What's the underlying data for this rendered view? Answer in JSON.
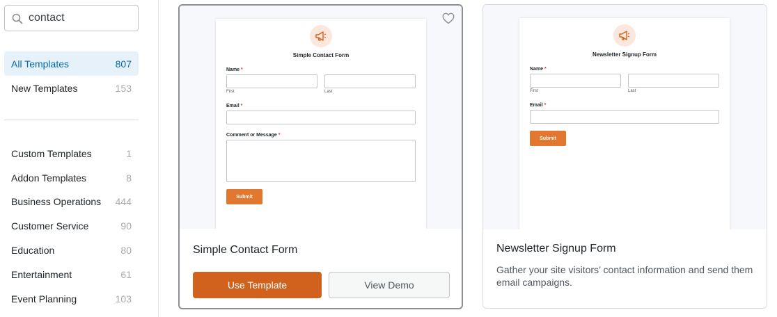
{
  "search": {
    "value": "contact"
  },
  "categories_top": [
    {
      "label": "All Templates",
      "count": "807",
      "active": true
    },
    {
      "label": "New Templates",
      "count": "153"
    }
  ],
  "categories": [
    {
      "label": "Custom Templates",
      "count": "1"
    },
    {
      "label": "Addon Templates",
      "count": "8"
    },
    {
      "label": "Business Operations",
      "count": "444"
    },
    {
      "label": "Customer Service",
      "count": "90"
    },
    {
      "label": "Education",
      "count": "80"
    },
    {
      "label": "Entertainment",
      "count": "61"
    },
    {
      "label": "Event Planning",
      "count": "103"
    }
  ],
  "templates": [
    {
      "name": "Simple Contact Form",
      "preview": {
        "title": "Simple Contact Form",
        "name_label": "Name",
        "first_label": "First",
        "last_label": "Last",
        "email_label": "Email",
        "message_label": "Comment or Message",
        "required_mark": "*",
        "submit_label": "Submit"
      },
      "use_label": "Use Template",
      "demo_label": "View Demo"
    },
    {
      "name": "Newsletter Signup Form",
      "description": "Gather your site visitors’ contact information and send them email campaigns.",
      "preview": {
        "title": "Newsletter Signup Form",
        "name_label": "Name",
        "first_label": "First",
        "last_label": "Last",
        "email_label": "Email",
        "required_mark": "*",
        "submit_label": "Submit"
      }
    }
  ],
  "colors": {
    "accent": "#d0621d",
    "submit": "#e27730",
    "active_bg": "#e7f1fa",
    "active_text": "#036aab"
  }
}
